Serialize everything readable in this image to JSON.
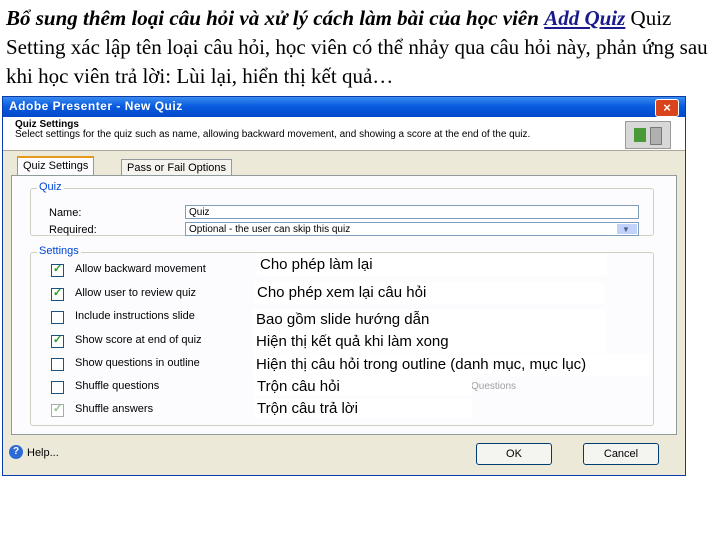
{
  "caption": {
    "title_prefix": "Bổ sung thêm loại câu hỏi và xử lý cách làm bài của học viên",
    "title_link": "Add Quiz",
    "body": "Quiz Setting xác lập tên loại câu hỏi, học viên có thể nhảy qua câu hỏi này, phản ứng sau khi học viên trả lời: Lùi lại, hiển thị kết quả…"
  },
  "dialog": {
    "title": "Adobe Presenter - New Quiz",
    "close": "×",
    "header_title": "Quiz Settings",
    "header_desc": "Select settings for the quiz such as name, allowing backward movement, and showing a score at the end of the quiz.",
    "tabs": [
      "Quiz Settings",
      "Pass or Fail Options"
    ],
    "quiz_group": "Quiz",
    "name_label": "Name:",
    "name_value": "Quiz",
    "required_label": "Required:",
    "required_value": "Optional - the user can skip this quiz",
    "settings_group": "Settings",
    "settings": [
      {
        "label": "Allow backward movement",
        "checked": true
      },
      {
        "label": "Allow user to review quiz",
        "checked": true
      },
      {
        "label": "Include instructions slide",
        "checked": false
      },
      {
        "label": "Show score at end of quiz",
        "checked": true
      },
      {
        "label": "Show questions in outline",
        "checked": false
      },
      {
        "label": "Shuffle questions",
        "checked": false
      },
      {
        "label": "Shuffle answers",
        "checked": true
      }
    ],
    "ghost_button": "Questions",
    "help": "Help...",
    "ok": "OK",
    "cancel": "Cancel"
  },
  "overlays": [
    "Cho phép làm lại",
    "Cho phép xem lại câu hỏi",
    "Bao gồm slide hướng dẫn",
    "Hiện thị kết quả khi làm xong",
    "Hiện thị câu hỏi trong outline (danh mục, mục lục)",
    "Trộn câu hỏi",
    "Trộn câu trả lời"
  ]
}
